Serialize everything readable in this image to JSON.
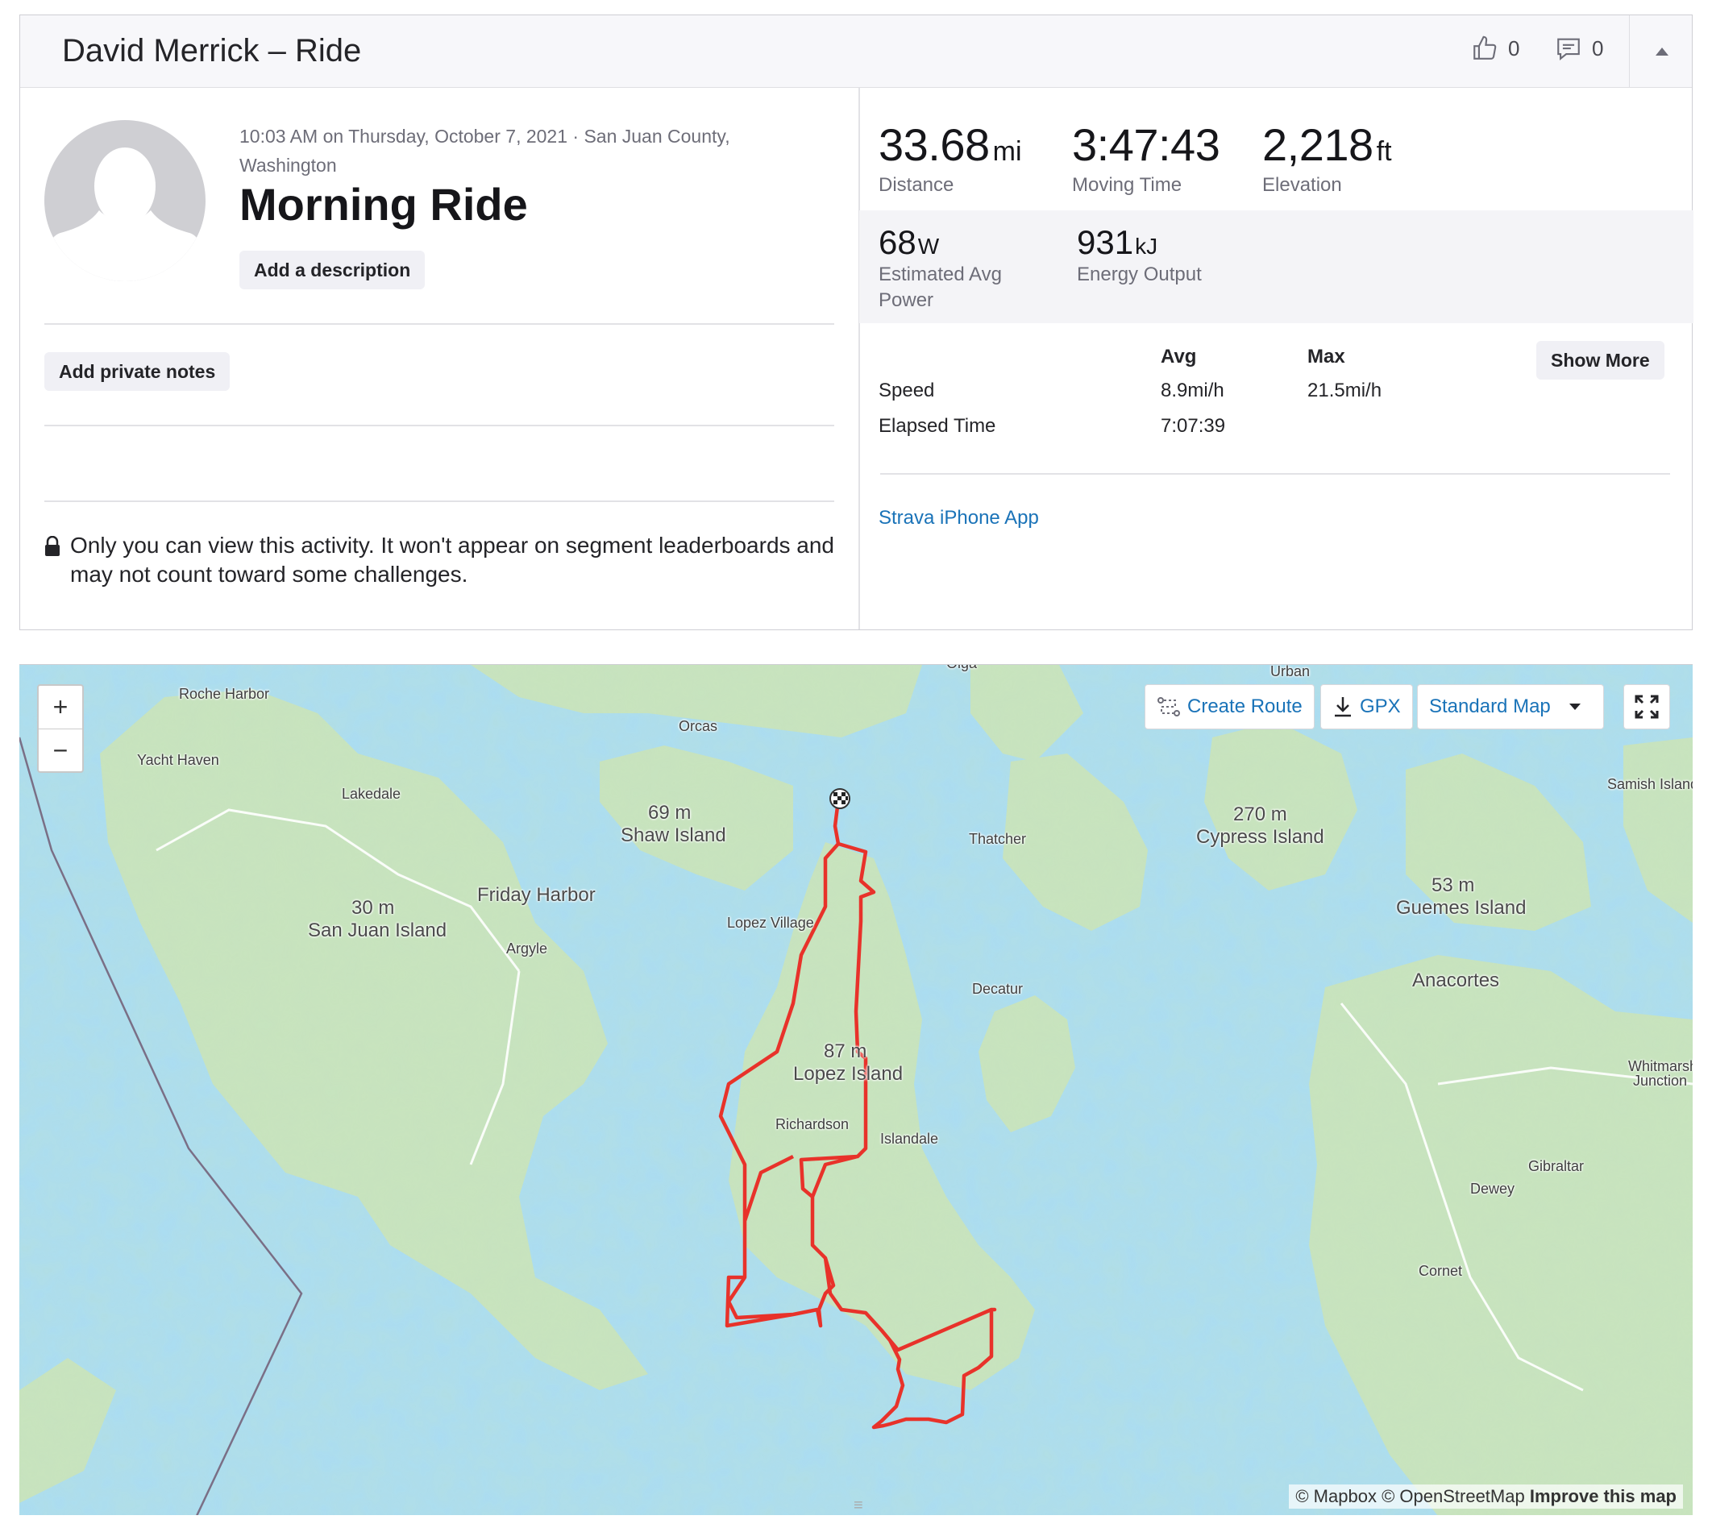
{
  "header": {
    "title": "David Merrick – Ride",
    "kudos_count": "0",
    "comment_count": "0"
  },
  "activity": {
    "meta": "10:03 AM on Thursday, October 7, 2021 · San Juan County, Washington",
    "name": "Morning Ride",
    "add_description_label": "Add a description",
    "add_private_notes_label": "Add private notes",
    "privacy_notice": "Only you can view this activity. It won't appear on segment leaderboards and may not count toward some challenges."
  },
  "stats": {
    "distance": {
      "value": "33.68",
      "unit": "mi",
      "label": "Distance"
    },
    "moving_time": {
      "value": "3:47:43",
      "label": "Moving Time"
    },
    "elevation": {
      "value": "2,218",
      "unit": "ft",
      "label": "Elevation"
    },
    "power": {
      "value": "68",
      "unit": "W",
      "label": "Estimated Avg Power"
    },
    "energy": {
      "value": "931",
      "unit": "kJ",
      "label": "Energy Output"
    }
  },
  "more_stats": {
    "col_avg": "Avg",
    "col_max": "Max",
    "show_more_label": "Show More",
    "rows": [
      {
        "label": "Speed",
        "avg": "8.9mi/h",
        "max": "21.5mi/h"
      },
      {
        "label": "Elapsed Time",
        "avg": "7:07:39",
        "max": ""
      }
    ],
    "device": "Strava iPhone App"
  },
  "map": {
    "zoom_in": "+",
    "zoom_out": "−",
    "create_route_label": "Create Route",
    "gpx_label": "GPX",
    "map_style_label": "Standard Map",
    "attribution_mapbox": "© Mapbox",
    "attribution_osm": "© OpenStreetMap",
    "attribution_improve": "Improve this map",
    "route_color": "#e8322a",
    "places": {
      "roche_harbor": "Roche Harbor",
      "yacht_haven": "Yacht Haven",
      "lakedale": "Lakedale",
      "orcas": "Orcas",
      "urban": "Urban",
      "olga": "Olga",
      "shaw_elev": "69 m",
      "shaw": "Shaw Island",
      "thatcher": "Thatcher",
      "cypress_elev": "270 m",
      "cypress": "Cypress Island",
      "samish": "Samish Island",
      "guemes_elev": "53 m",
      "guemes": "Guemes Island",
      "sanjuan_elev": "30 m",
      "sanjuan": "San Juan Island",
      "friday_harbor": "Friday Harbor",
      "argyle": "Argyle",
      "lopez_village": "Lopez Village",
      "decatur": "Decatur",
      "anacortes": "Anacortes",
      "lopez_elev": "87 m",
      "lopez": "Lopez Island",
      "richardson": "Richardson",
      "islandale": "Islandale",
      "whitmarsh_1": "Whitmarsh",
      "whitmarsh_2": "Junction",
      "gibraltar": "Gibraltar",
      "dewey": "Dewey",
      "cornet": "Cornet"
    }
  }
}
